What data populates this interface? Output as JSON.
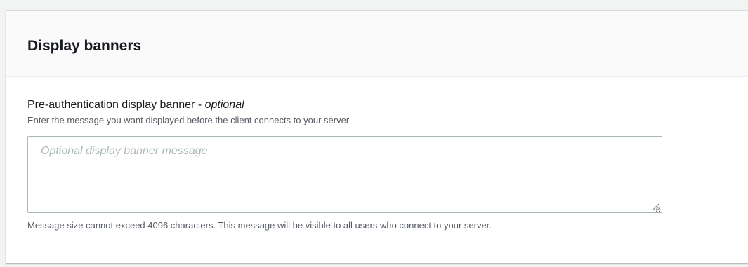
{
  "panel": {
    "title": "Display banners"
  },
  "field": {
    "label": "Pre-authentication display banner - ",
    "label_optional": "optional",
    "description": "Enter the message you want displayed before the client connects to your server",
    "placeholder": "Optional display banner message",
    "value": "",
    "constraint": "Message size cannot exceed 4096 characters. This message will be visible to all users who connect to your server."
  },
  "colors": {
    "page_background": "#f2f3f3",
    "panel_header_background": "#fafafa",
    "text_primary": "#16191f",
    "text_secondary": "#545b64",
    "input_border": "#aab7b8",
    "placeholder": "#aab7b8"
  }
}
